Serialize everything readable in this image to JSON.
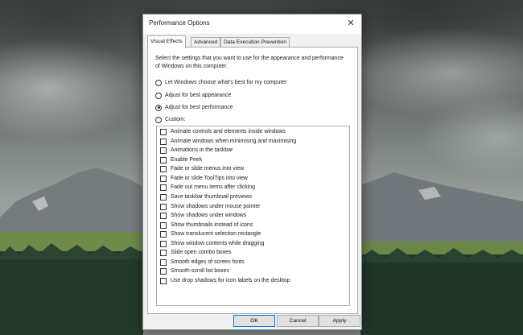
{
  "dialog": {
    "title": "Performance Options",
    "close_glyph": "✕",
    "tabs": [
      {
        "label": "Visual Effects",
        "active": true
      },
      {
        "label": "Advanced",
        "active": false
      },
      {
        "label": "Data Execution Prevention",
        "active": false
      }
    ],
    "description": "Select the settings that you want to use for the appearance and performance of Windows on this computer.",
    "radios": [
      {
        "label": "Let Windows choose what's best for my computer",
        "selected": false
      },
      {
        "label": "Adjust for best appearance",
        "selected": false
      },
      {
        "label": "Adjust for best performance",
        "selected": true
      },
      {
        "label": "Custom:",
        "selected": false
      }
    ],
    "effects": [
      {
        "label": "Animate controls and elements inside windows",
        "checked": false
      },
      {
        "label": "Animate windows when minimising and maximising",
        "checked": false
      },
      {
        "label": "Animations in the taskbar",
        "checked": false
      },
      {
        "label": "Enable Peek",
        "checked": false
      },
      {
        "label": "Fade or slide menus into view",
        "checked": false
      },
      {
        "label": "Fade or slide ToolTips into view",
        "checked": false
      },
      {
        "label": "Fade out menu items after clicking",
        "checked": false
      },
      {
        "label": "Save taskbar thumbnail previews",
        "checked": false
      },
      {
        "label": "Show shadows under mouse pointer",
        "checked": false
      },
      {
        "label": "Show shadows under windows",
        "checked": false
      },
      {
        "label": "Show thumbnails instead of icons",
        "checked": false
      },
      {
        "label": "Show translucent selection rectangle",
        "checked": false
      },
      {
        "label": "Show window contents while dragging",
        "checked": false
      },
      {
        "label": "Slide open combo boxes",
        "checked": false
      },
      {
        "label": "Smooth edges of screen fonts",
        "checked": false
      },
      {
        "label": "Smooth-scroll list boxes",
        "checked": false
      },
      {
        "label": "Use drop shadows for icon labels on the desktop",
        "checked": false
      }
    ],
    "buttons": {
      "ok": "OK",
      "cancel": "Cancel",
      "apply": "Apply"
    }
  },
  "colors": {
    "accent": "#0078d7",
    "dialog_bg": "#f0f0f0",
    "panel_bg": "#ffffff",
    "border": "#adadad"
  }
}
